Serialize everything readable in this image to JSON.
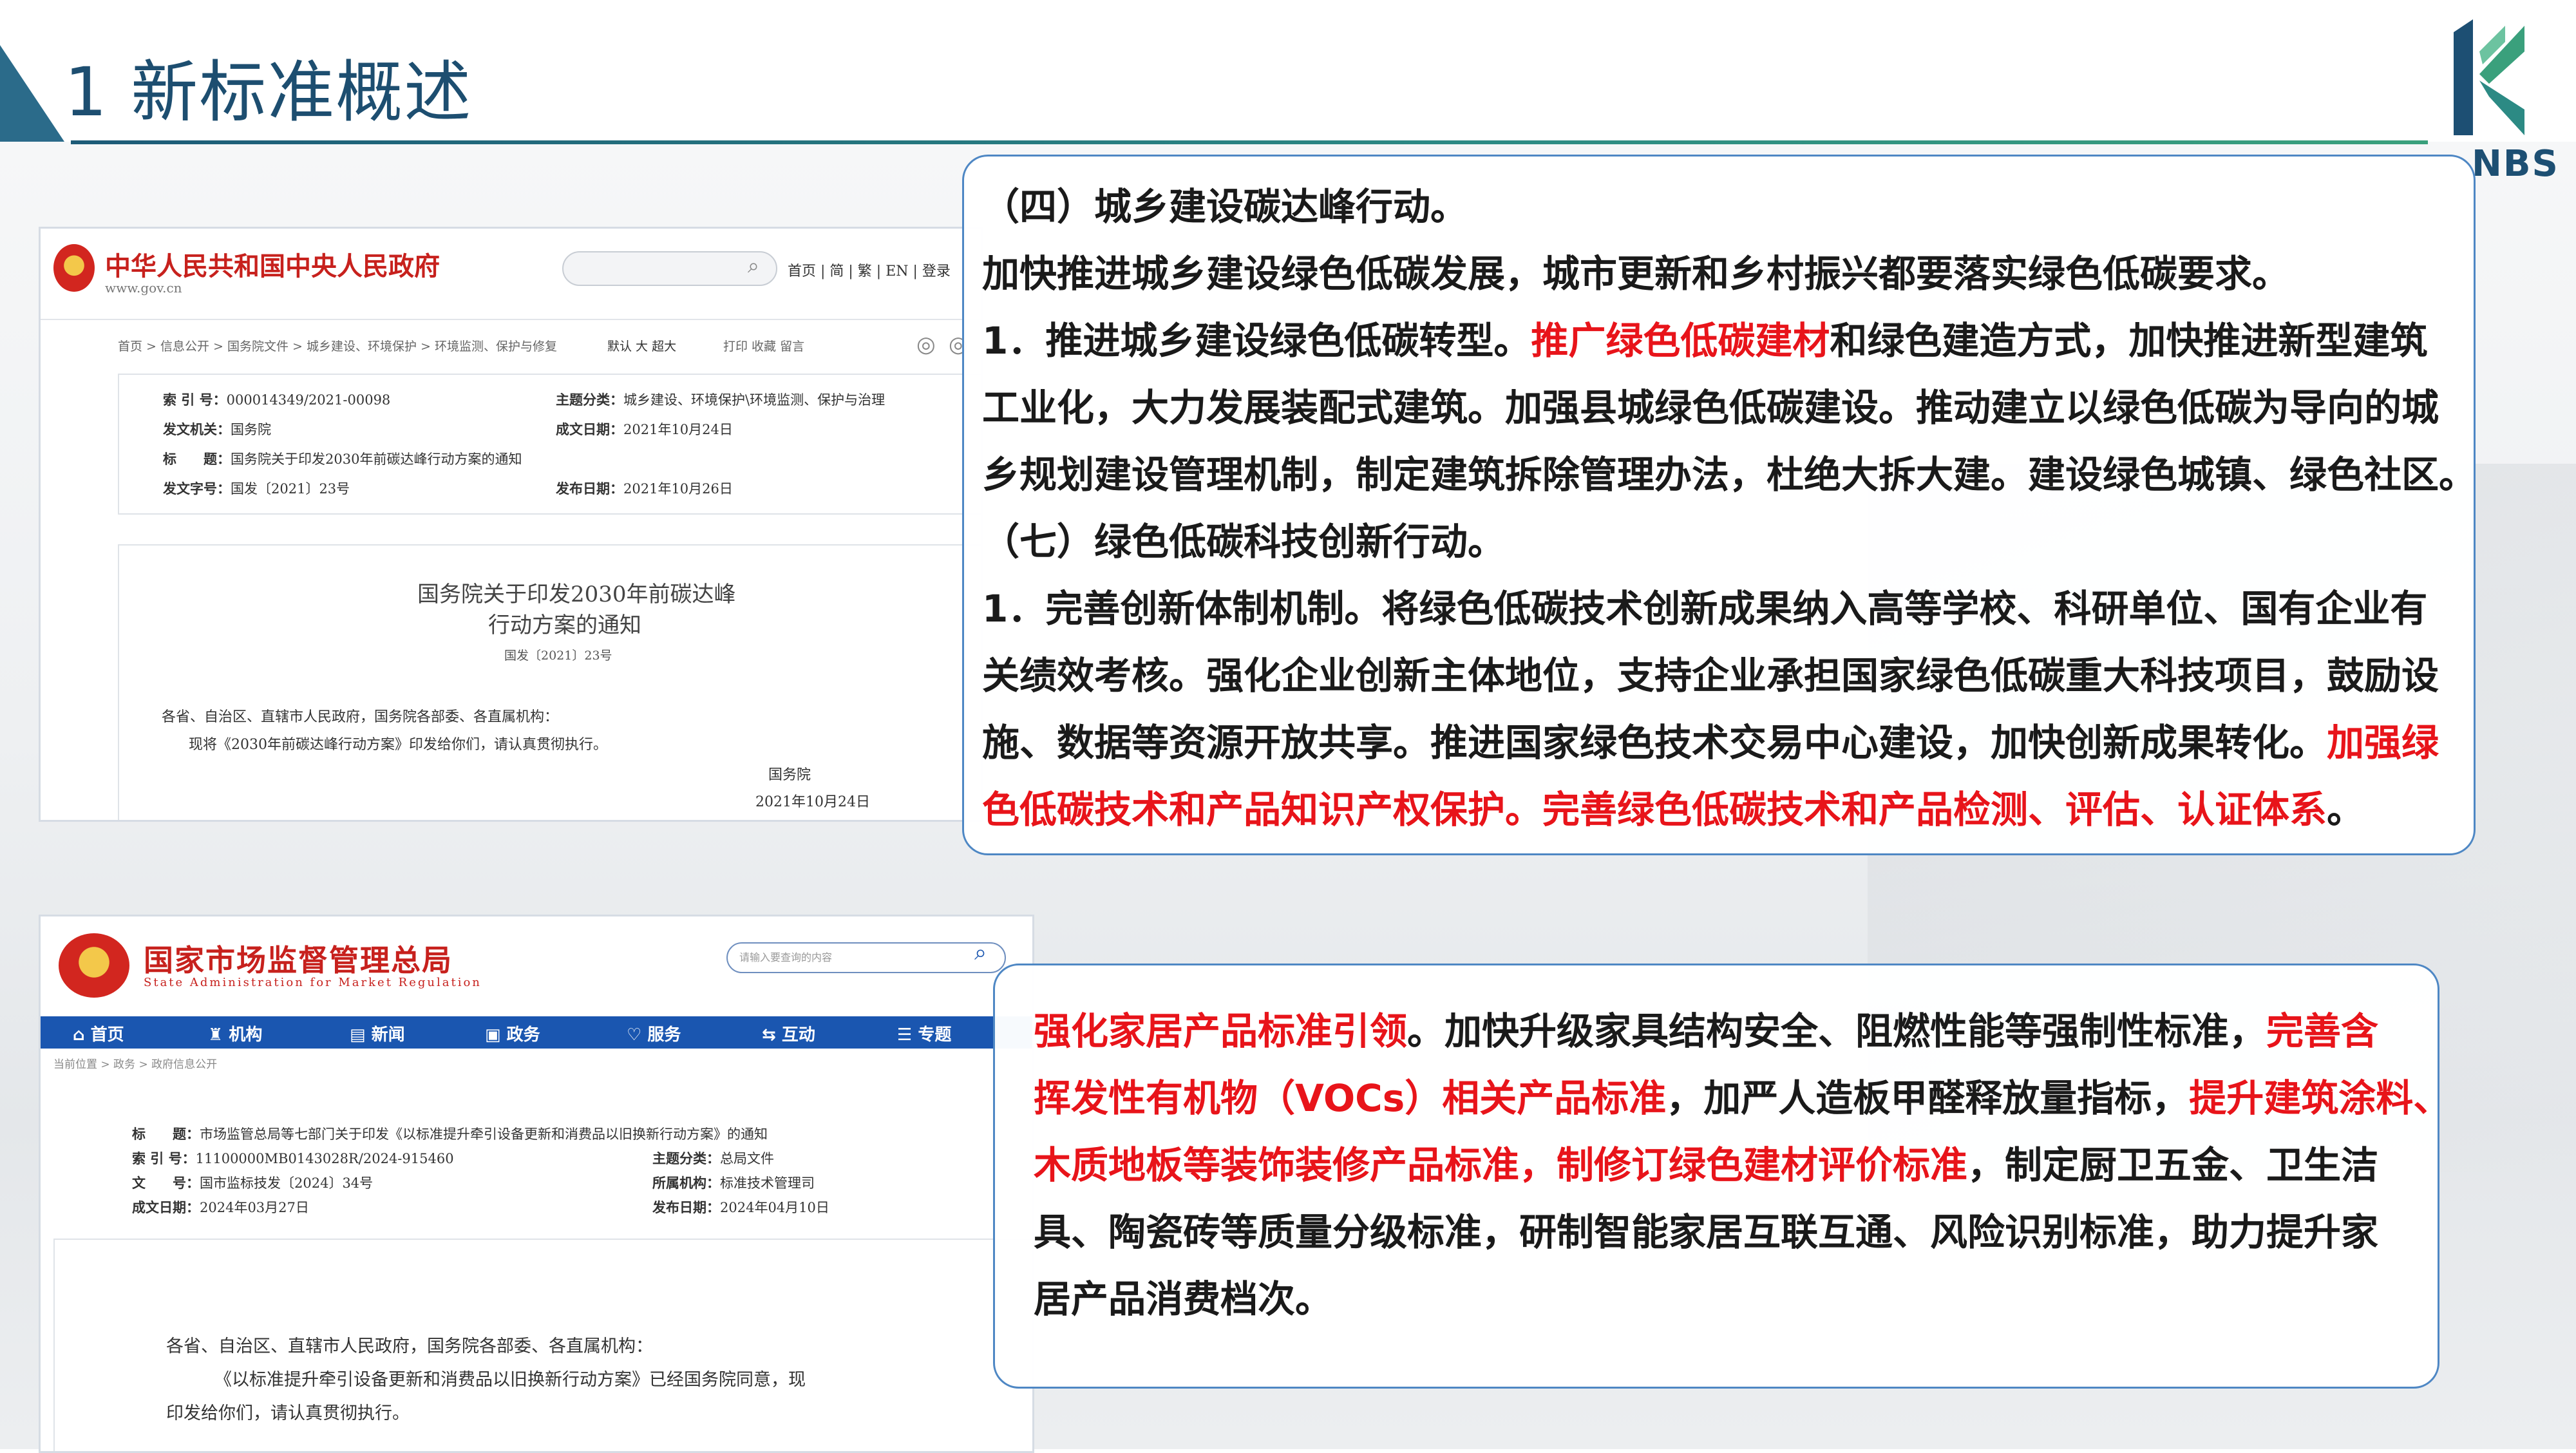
{
  "header": {
    "title": "1 新标准概述",
    "logo_text": "NBS"
  },
  "gov_site": {
    "site_name": "中华人民共和国中央人民政府",
    "domain": "www.gov.cn",
    "top_nav": "首页 | 简 | 繁 | EN | 登录",
    "breadcrumb": "首页 > 信息公开 > 国务院文件 > 城乡建设、环境保护 > 环境监测、保护与修复",
    "font_controls": "默认  大  超大",
    "tools": "打印  收藏  留言",
    "meta": {
      "index_label": "索 引 号：",
      "index_value": "000014349/2021-00098",
      "category_label": "主题分类：",
      "category_value": "城乡建设、环境保护\\环境监测、保护与治理",
      "issuer_label": "发文机关：",
      "issuer_value": "国务院",
      "created_label": "成文日期：",
      "created_value": "2021年10月24日",
      "title_label": "标　　题：",
      "title_value": "国务院关于印发2030年前碳达峰行动方案的通知",
      "docno_label": "发文字号：",
      "docno_value": "国发〔2021〕23号",
      "published_label": "发布日期：",
      "published_value": "2021年10月26日"
    },
    "doc": {
      "title_line1": "国务院关于印发2030年前碳达峰",
      "title_line2": "行动方案的通知",
      "docno": "国发〔2021〕23号",
      "addressee": "各省、自治区、直辖市人民政府，国务院各部委、各直属机构：",
      "body": "现将《2030年前碳达峰行动方案》印发给你们，请认真贯彻执行。",
      "signer": "国务院",
      "date": "2021年10月24日"
    }
  },
  "samr_site": {
    "site_name": "国家市场监督管理总局",
    "site_name_en": "State Administration for Market Regulation",
    "search_placeholder": "请输入要查询的内容",
    "nav": [
      "首页",
      "机构",
      "新闻",
      "政务",
      "服务",
      "互动",
      "专题"
    ],
    "breadcrumb": "当前位置 > 政务 > 政府信息公开",
    "meta": {
      "title_label": "标　　题：",
      "title_value": "市场监管总局等七部门关于印发《以标准提升牵引设备更新和消费品以旧换新行动方案》的通知",
      "index_label": "索 引 号：",
      "index_value": "11100000MB0143028R/2024-915460",
      "category_label": "主题分类：",
      "category_value": "总局文件",
      "docno_label": "文　　号：",
      "docno_value": "国市监标技发〔2024〕34号",
      "org_label": "所属机构：",
      "org_value": "标准技术管理司",
      "created_label": "成文日期：",
      "created_value": "2024年03月27日",
      "published_label": "发布日期：",
      "published_value": "2024年04月10日"
    },
    "doc": {
      "addressee": "各省、自治区、直辖市人民政府，国务院各部委、各直属机构：",
      "body1": "《以标准提升牵引设备更新和消费品以旧换新行动方案》已经国务院同意，现",
      "body2": "印发给你们，请认真贯彻执行。"
    }
  },
  "card1": {
    "l1": "（四）城乡建设碳达峰行动。",
    "l2": "加快推进城乡建设绿色低碳发展，城市更新和乡村振兴都要落实绿色低碳要求。",
    "l3a": "1．推进城乡建设绿色低碳转型。",
    "l3b": "推广绿色低碳建材",
    "l3c": "和绿色建造方式，加快推进新型建筑",
    "l4": "工业化，大力发展装配式建筑。加强县城绿色低碳建设。推动建立以绿色低碳为导向的城",
    "l5": "乡规划建设管理机制，制定建筑拆除管理办法，杜绝大拆大建。建设绿色城镇、绿色社区。",
    "l6": "（七）绿色低碳科技创新行动。",
    "l7": "1．完善创新体制机制。将绿色低碳技术创新成果纳入高等学校、科研单位、国有企业有",
    "l8": "关绩效考核。强化企业创新主体地位，支持企业承担国家绿色低碳重大科技项目，鼓励设",
    "l9a": "施、数据等资源开放共享。推进国家绿色技术交易中心建设，加快创新成果转化。",
    "l9b": "加强绿",
    "l10a": "色低碳技术和产品知识产权保护。完善绿色低碳技术和产品检测、评估、认证体系",
    "l10b": "。"
  },
  "card2": {
    "l1a": "强化家居产品标准引领",
    "l1b": "。加快升级家具结构安全、阻燃性能等强制性标准，",
    "l1c": "完善含",
    "l2a": "挥发性有机物（VOCs）相关产品标准",
    "l2b": "，加严人造板甲醛释放量指标，",
    "l2c": "提升建筑涂料、",
    "l3a": "木质地板等装饰装修产品标准，制修订绿色建材评价标准",
    "l3b": "，制定厨卫五金、卫生洁",
    "l4": "具、陶瓷砖等质量分级标准，研制智能家居互联互通、风险识别标准，助力提升家",
    "l5": "居产品消费档次。"
  },
  "colors": {
    "title_blue": "#1d4e70",
    "highlight_red": "#e8141a",
    "card_border": "#4e87c4",
    "gov_red": "#c7211d",
    "samr_nav_blue": "#1a56b0"
  }
}
